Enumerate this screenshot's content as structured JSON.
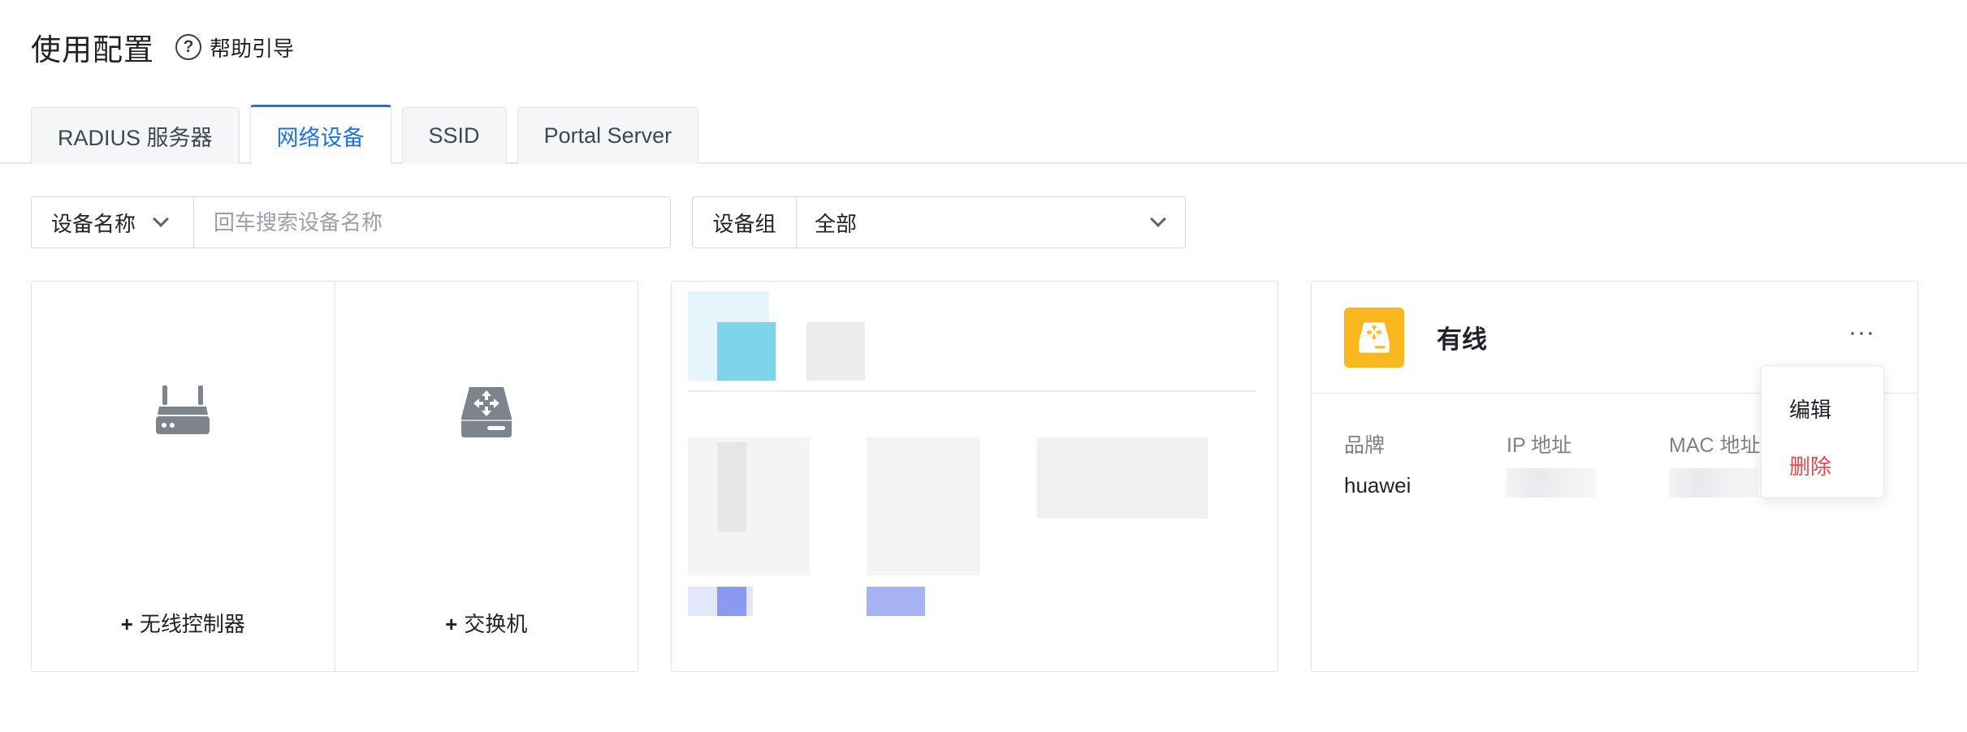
{
  "page": {
    "title": "使用配置",
    "help_label": "帮助引导"
  },
  "tabs": [
    {
      "label": "RADIUS 服务器",
      "active": false
    },
    {
      "label": "网络设备",
      "active": true
    },
    {
      "label": "SSID",
      "active": false
    },
    {
      "label": "Portal Server",
      "active": false
    }
  ],
  "filters": {
    "field_select": "设备名称",
    "search_placeholder": "回车搜索设备名称",
    "group_label": "设备组",
    "group_value": "全部"
  },
  "add_actions": {
    "wireless_label": "无线控制器",
    "switch_label": "交换机"
  },
  "device_card": {
    "name": "有线",
    "more_label": "···",
    "brand_key": "品牌",
    "brand_value": "huawei",
    "ip_key": "IP 地址",
    "mac_key": "MAC 地址",
    "icon_color": "#fbb81e"
  },
  "dropdown": {
    "edit": "编辑",
    "delete": "删除"
  },
  "colors": {
    "accent": "#1e72e6",
    "danger": "#e5484d"
  }
}
